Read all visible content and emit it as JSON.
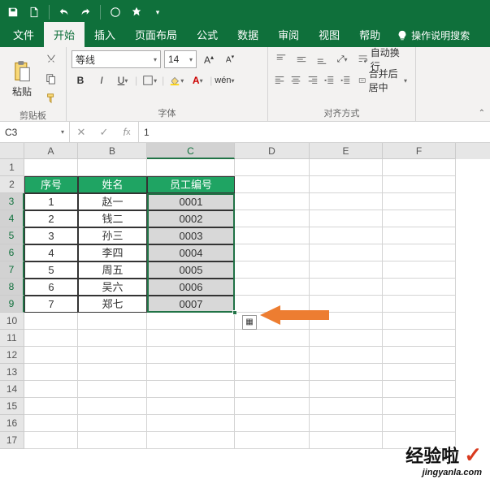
{
  "qat": {
    "save": "",
    "new": "",
    "undo": "",
    "redo": "",
    "print": "",
    "touch": ""
  },
  "tabs": {
    "file": "文件",
    "home": "开始",
    "insert": "插入",
    "layout": "页面布局",
    "formulas": "公式",
    "data": "数据",
    "review": "审阅",
    "view": "视图",
    "help": "帮助",
    "tell": "操作说明搜索"
  },
  "ribbon": {
    "clipboard": {
      "paste": "粘贴",
      "group": "剪贴板"
    },
    "font": {
      "name": "等线",
      "size": "14",
      "bold": "B",
      "italic": "I",
      "underline": "U",
      "group": "字体"
    },
    "align": {
      "wrap": "自动换行",
      "merge": "合并后居中",
      "group": "对齐方式"
    }
  },
  "fbar": {
    "namebox": "C3",
    "formula": "1"
  },
  "cols": {
    "A": "A",
    "B": "B",
    "C": "C",
    "D": "D",
    "E": "E",
    "F": "F"
  },
  "col_widths": {
    "A": 66,
    "B": 85,
    "C": 108,
    "D": 92,
    "E": 90,
    "F": 90
  },
  "rows": [
    "1",
    "2",
    "3",
    "4",
    "5",
    "6",
    "7",
    "8",
    "9",
    "10",
    "11",
    "12",
    "13",
    "14",
    "15",
    "16",
    "17"
  ],
  "table": {
    "headers": {
      "a": "序号",
      "b": "姓名",
      "c": "员工编号"
    },
    "rows": [
      {
        "a": "1",
        "b": "赵一",
        "c": "0001"
      },
      {
        "a": "2",
        "b": "钱二",
        "c": "0002"
      },
      {
        "a": "3",
        "b": "孙三",
        "c": "0003"
      },
      {
        "a": "4",
        "b": "李四",
        "c": "0004"
      },
      {
        "a": "5",
        "b": "周五",
        "c": "0005"
      },
      {
        "a": "6",
        "b": "吴六",
        "c": "0006"
      },
      {
        "a": "7",
        "b": "郑七",
        "c": "0007"
      }
    ]
  },
  "watermark": {
    "line1": "经验啦",
    "check": "✓",
    "line2": "jingyanla.com"
  }
}
